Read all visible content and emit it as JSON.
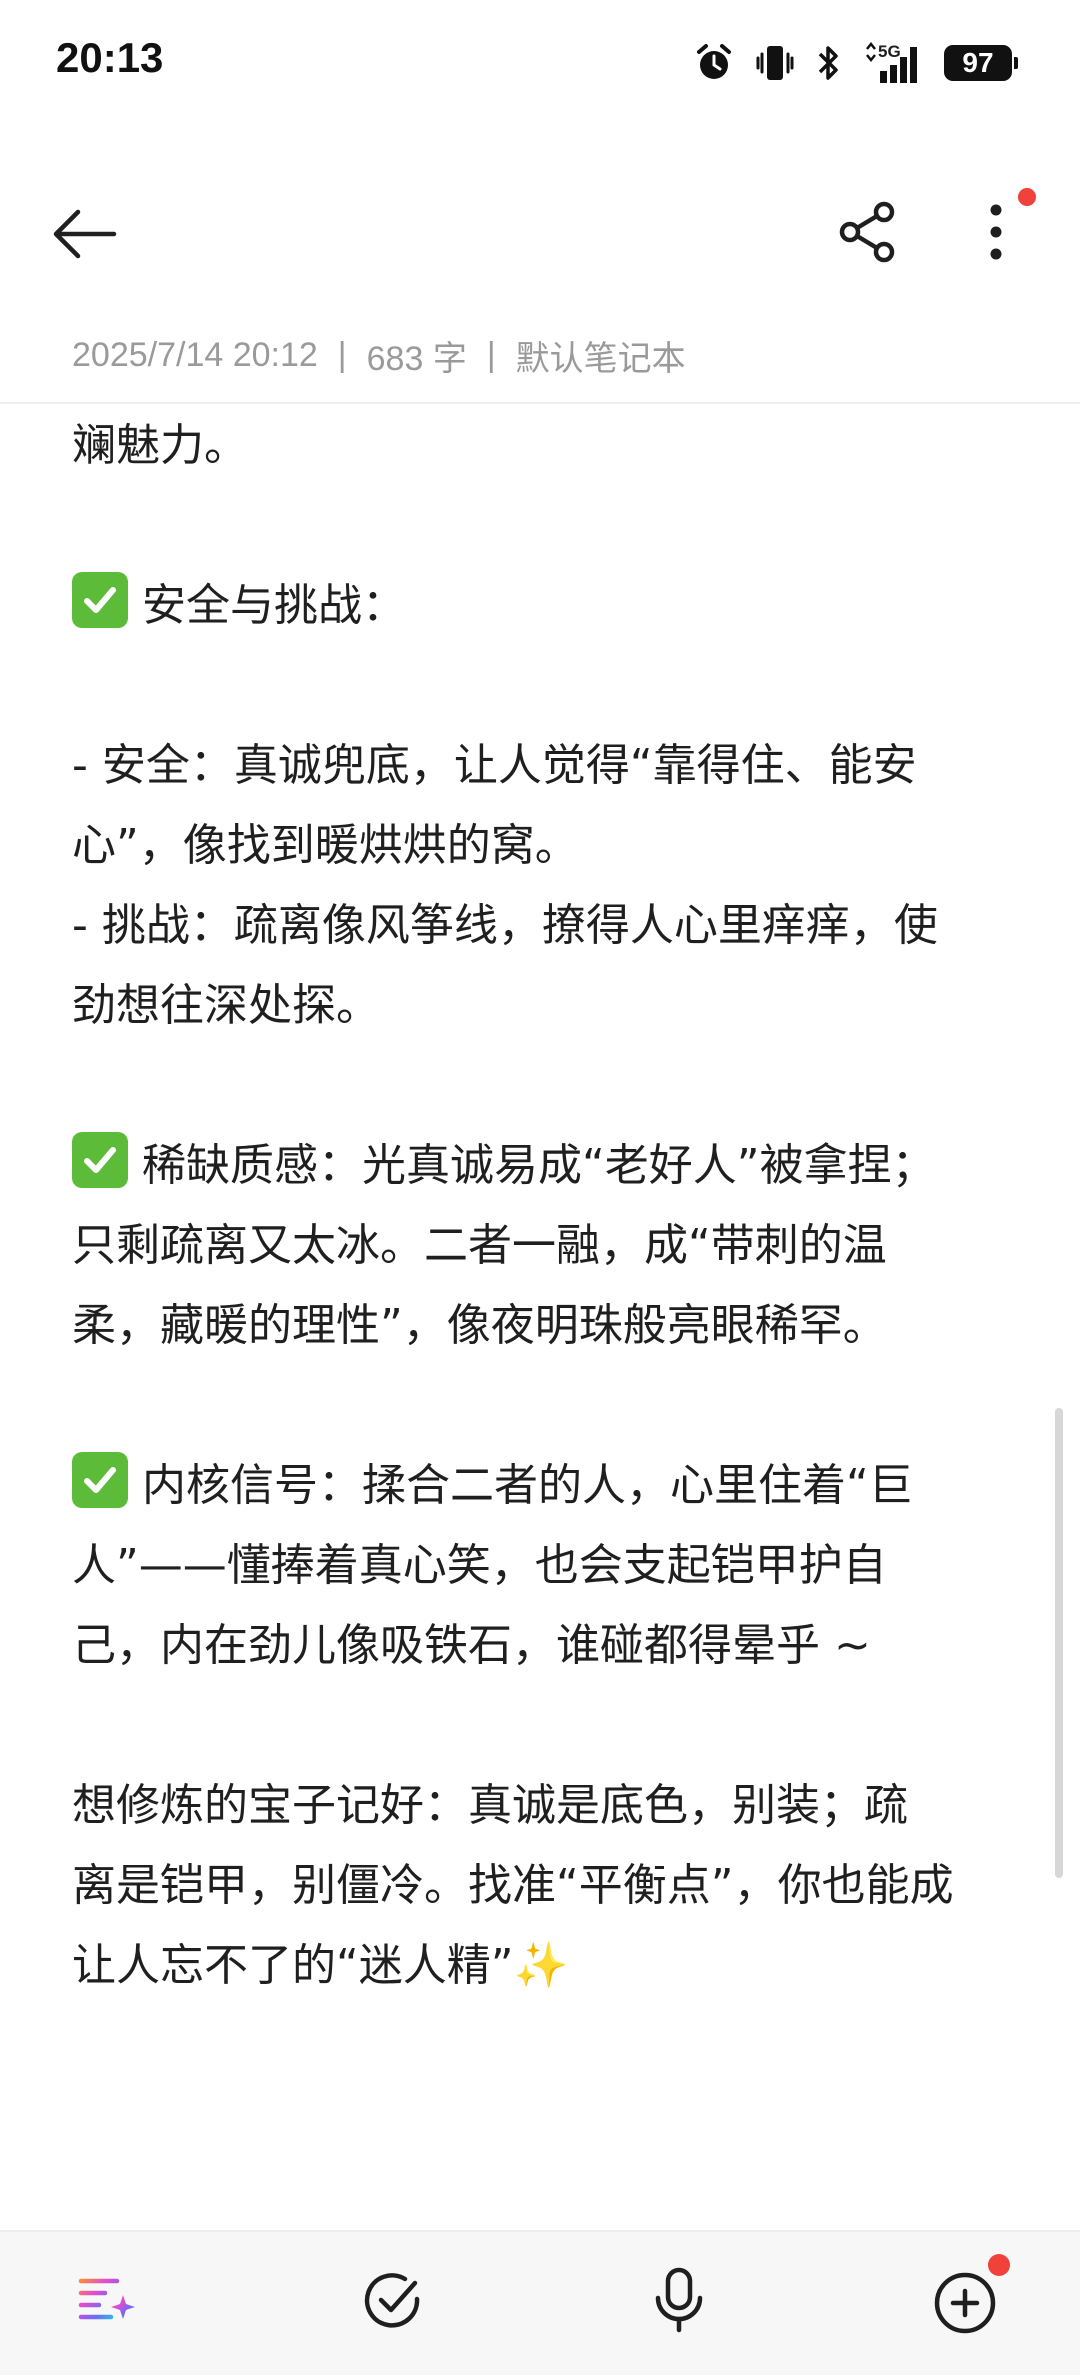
{
  "status": {
    "time": "20:13",
    "network": "5G",
    "battery": "97"
  },
  "meta": {
    "datetime": "2025/7/14 20:12",
    "separator": "|",
    "word_count": "683 字",
    "notebook": "默认笔记本"
  },
  "note": {
    "lines": [
      "斓魅力。",
      "",
      "安全与挑战：",
      "",
      "- 安全：真诚兜底，让人觉得“靠得住、能安",
      "心”，像找到暖烘烘的窝。",
      "- 挑战：疏离像风筝线，撩得人心里痒痒，使",
      "劲想往深处探。",
      "",
      "稀缺质感：光真诚易成“老好人”被拿捏；",
      "只剩疏离又太冰。二者一融，成“带刺的温",
      "柔，藏暖的理性”，像夜明珠般亮眼稀罕。",
      "",
      "内核信号：揉合二者的人，心里住着“巨",
      "人”——懂捧着真心笑，也会支起铠甲护自",
      "己，内在劲儿像吸铁石，谁碰都得晕乎 ~",
      "",
      "想修炼的宝子记好：真诚是底色，别装；疏",
      "离是铠甲，别僵冷。找准“平衡点”，你也能成",
      "让人忘不了的“迷人精”✨"
    ]
  },
  "colors": {
    "check_green": "#5dbb3a",
    "badge_red": "#f0413a",
    "meta_gray": "#9a9a9a"
  },
  "icons": {
    "back": "arrow-left-icon",
    "share": "share-icon",
    "more": "more-vertical-icon",
    "ai": "ai-sparkle-icon",
    "todo": "check-circle-icon",
    "mic": "microphone-icon",
    "add": "plus-circle-icon"
  }
}
